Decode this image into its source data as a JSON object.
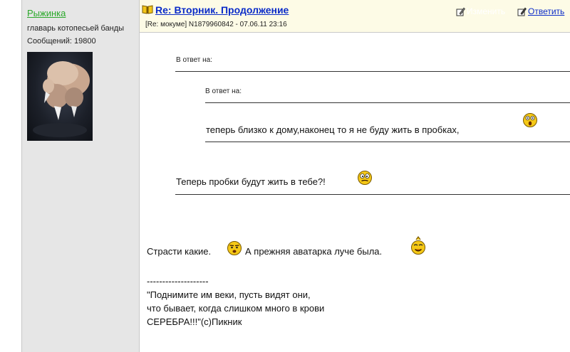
{
  "author": {
    "username": "Рыжинка",
    "rank": "главарь котопесьей банды",
    "post_count": "Сообщений: 19800"
  },
  "post": {
    "title": "Re: Вторник. Продолжение",
    "meta": "[Re: мокуме]  N1879960842 - 07.06.11 23:16",
    "edit_label": "Изменить",
    "reply_label": "Ответить"
  },
  "quotes": {
    "outer_label": "В ответ на:",
    "inner_label": "В ответ на:",
    "inner_text": "теперь близко к дому,наконец то я не буду жить в пробках,",
    "outer_text": "Теперь пробки будут жить в тебе?!"
  },
  "body": {
    "text_part1": "Страсти какие.",
    "text_part2": "А прежняя аватарка луче была."
  },
  "signature": {
    "separator": "--------------------",
    "line1": "\"Поднимите им веки, пусть видят они,",
    "line2": "что бывает, когда слишком много в крови",
    "line3": "СЕРЕБРА!!!\"(с)Пикник"
  },
  "icons": [
    "book-icon",
    "edit-icon",
    "reply-icon",
    "smiley-scared-icon",
    "smiley-confused-icon",
    "smiley-surprised-icon",
    "smiley-pleased-icon"
  ],
  "colors": {
    "username": "#2ba82b",
    "title_link": "#0a2bc8",
    "header_bg": "#fdfbe6",
    "sidebar_bg": "#e6e6e6",
    "smiley": "#f5c816"
  }
}
